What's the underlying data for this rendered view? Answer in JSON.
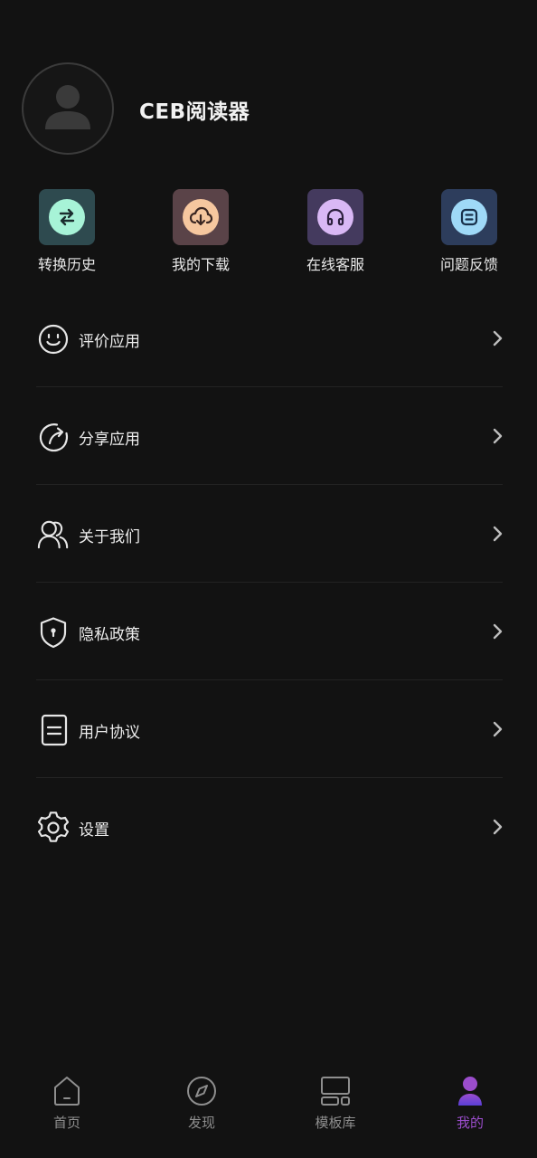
{
  "profile": {
    "app_title": "CEB阅读器"
  },
  "quick_actions": [
    {
      "label": "转换历史",
      "icon": "swap-arrows-icon",
      "tile_color": "#2e4a4f",
      "circle_color": "#a7f3d7"
    },
    {
      "label": "我的下载",
      "icon": "cloud-download-icon",
      "tile_color": "#5a4348",
      "circle_color": "#f6c79f"
    },
    {
      "label": "在线客服",
      "icon": "headphones-icon",
      "tile_color": "#443a5e",
      "circle_color": "#d9b8f5"
    },
    {
      "label": "问题反馈",
      "icon": "feedback-icon",
      "tile_color": "#2d3d5c",
      "circle_color": "#9fd9f7"
    }
  ],
  "menu": [
    {
      "label": "评价应用",
      "icon": "smiley-icon"
    },
    {
      "label": "分享应用",
      "icon": "share-icon"
    },
    {
      "label": "关于我们",
      "icon": "users-icon"
    },
    {
      "label": "隐私政策",
      "icon": "shield-icon"
    },
    {
      "label": "用户协议",
      "icon": "document-icon"
    },
    {
      "label": "设置",
      "icon": "gear-icon"
    }
  ],
  "bottom_nav": [
    {
      "label": "首页",
      "icon": "home-icon"
    },
    {
      "label": "发现",
      "icon": "compass-icon"
    },
    {
      "label": "模板库",
      "icon": "template-icon"
    },
    {
      "label": "我的",
      "icon": "profile-icon",
      "active": true
    }
  ],
  "colors": {
    "background": "#121212",
    "accent": "#9b4dcc",
    "nav_inactive": "#8e8e8e"
  }
}
